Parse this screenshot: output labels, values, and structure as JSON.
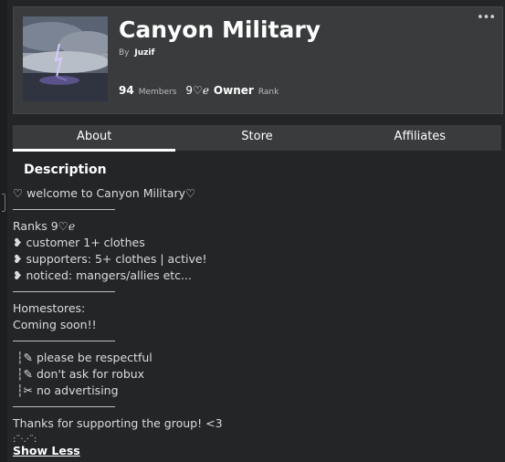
{
  "group": {
    "name": "Canyon Military",
    "by_prefix": "By",
    "owner": "Juzif",
    "members_count": "94",
    "members_label": "Members",
    "rank_name": "9♡ℯ",
    "rank_role": "Owner",
    "rank_label": "Rank",
    "more_icon": "•••"
  },
  "tabs": [
    {
      "label": "About",
      "active": true
    },
    {
      "label": "Store",
      "active": false
    },
    {
      "label": "Affiliates",
      "active": false
    }
  ],
  "description": {
    "title": "Description",
    "lines": {
      "l1": "♡ welcome to Canyon Military♡",
      "l3": "Ranks 9♡ℯ",
      "l4": "❥ customer 1+ clothes",
      "l5": "❥ supporters: 5+ clothes | active!",
      "l6": "❥ noticed: mangers/allies etc...",
      "l8": "Homestores:",
      "l9": "Coming soon!!",
      "l11": " ┆✎ please be respectful",
      "l12": " ┆✎ don't ask for robux",
      "l13": " ┆✂ no advertising",
      "l15": "Thanks for supporting the group! <3",
      "l16": ":¨·.·¨:"
    },
    "show_less": "Show Less"
  }
}
